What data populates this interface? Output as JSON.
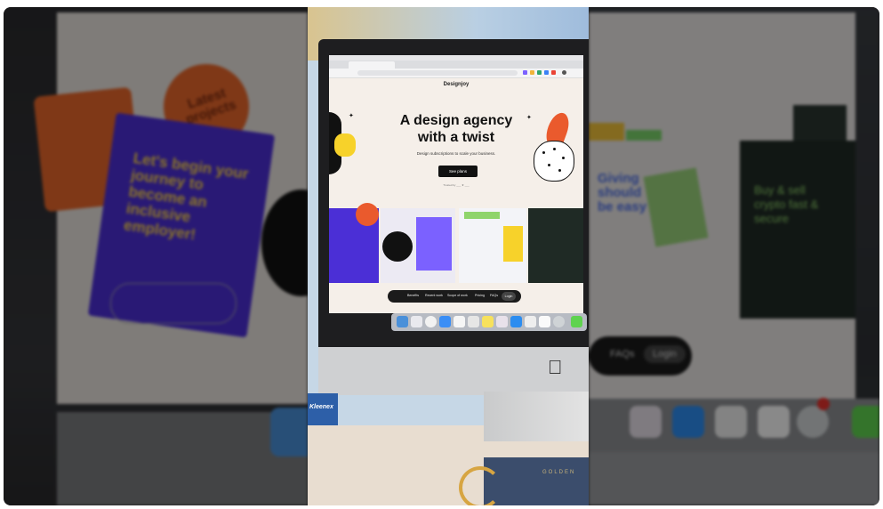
{
  "left_panel": {
    "burst_text": "Latest projects",
    "card_text": "Let's begin your journey to become an inclusive employer!"
  },
  "right_panel": {
    "blue_text": "Giving should be easy",
    "dark_text": "Buy & sell crypto fast & secure",
    "nav_faqs": "FAQs",
    "nav_login": "Login"
  },
  "photo": {
    "tissue_label": "Kleenex",
    "notebook_label": "GOLDEN"
  },
  "website": {
    "logo": "Designjoy",
    "headline_line1": "A design agency",
    "headline_line2": "with a twist",
    "subheadline": "Design subscriptions to scale your business.",
    "cta_label": "See plans",
    "trust_text": "Trusted by ___ ★ ___",
    "nav": {
      "items": [
        "Benefits",
        "Recent work",
        "Scope of work",
        "Pricing",
        "FAQs"
      ],
      "login": "Login"
    }
  },
  "colors": {
    "accent_orange": "#ea5a2d",
    "accent_yellow": "#f7d22a",
    "accent_purple": "#4b2fd6",
    "site_bg": "#f5efe9"
  }
}
